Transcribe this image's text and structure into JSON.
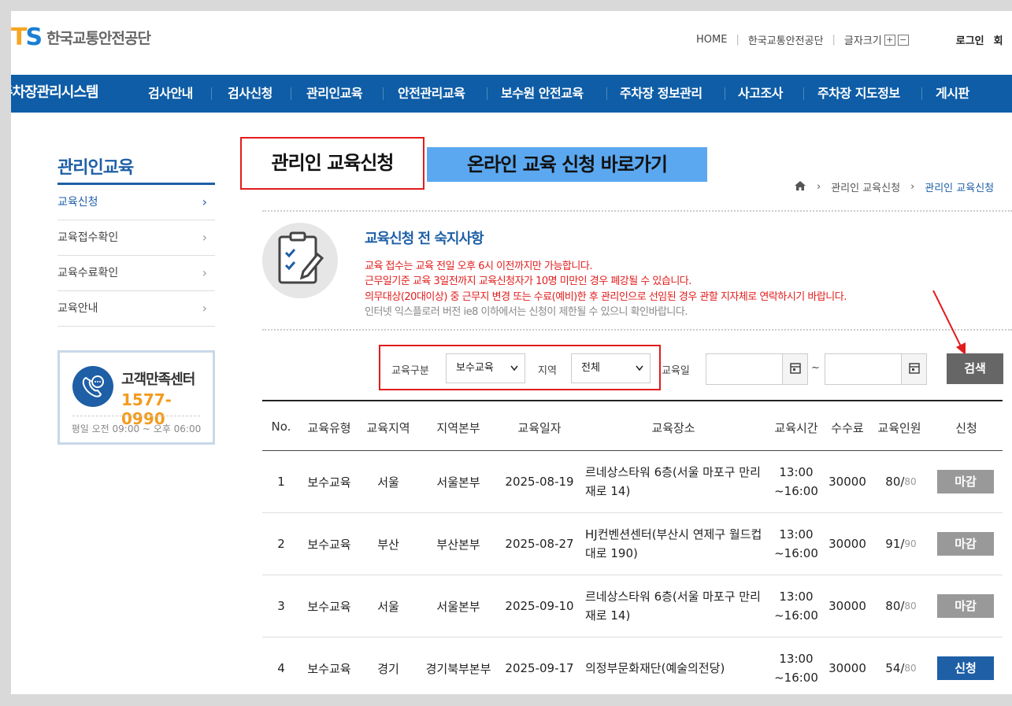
{
  "header": {
    "logo_mark": "TS",
    "logo_text": "한국교통안전공단",
    "util": {
      "home": "HOME",
      "org": "한국교통안전공단",
      "font_size": "글자크기",
      "font_plus": "+",
      "font_minus": "−",
      "login": "로그인",
      "more": "회"
    }
  },
  "nav": {
    "system_title": "주차장관리시스템",
    "items": [
      "검사안내",
      "검사신청",
      "관리인교육",
      "안전관리교육",
      "보수원 안전교육",
      "주차장 정보관리",
      "사고조사",
      "주차장 지도정보",
      "게시판"
    ]
  },
  "sidebar": {
    "title": "관리인교육",
    "items": [
      "교육신청",
      "교육접수확인",
      "교육수료확인",
      "교육안내"
    ],
    "arrow": "›",
    "cs": {
      "title": "고객만족센터",
      "phone": "1577-0990",
      "hours": "평일 오전 09:00 ~ 오후 06:00"
    }
  },
  "main": {
    "title": "관리인 교육신청",
    "online_link": "온라인 교육 신청 바로가기",
    "breadcrumb": [
      "관리인 교육신청",
      "관리인 교육신청"
    ],
    "breadcrumb_sep": "›",
    "notice": {
      "title": "교육신청 전 숙지사항",
      "lines_red": [
        "교육 접수는 교육 전일 오후 6시 이전까지만 가능합니다.",
        "근무일기준 교육 3일전까지 교육신청자가 10명 미만인 경우 폐강될 수 있습니다.",
        "의무대상(20대이상) 중 근무지 변경 또는 수료(예비)한 후 관리인으로 선임된 경우 관할 지자체로 연락하시기 바랍니다."
      ],
      "line_gray": "인터넷 익스플로러 버전 ie8 이하에서는 신청이 제한될 수 있으니 확인바랍니다."
    },
    "search": {
      "type_label": "교육구분",
      "type_value": "보수교육",
      "region_label": "지역",
      "region_value": "전체",
      "date_label": "교육일",
      "tilde": "~",
      "button": "검색"
    },
    "table": {
      "headers": [
        "No.",
        "교육유형",
        "교육지역",
        "지역본부",
        "교육일자",
        "교육장소",
        "교육시간",
        "수수료",
        "교육인원",
        "신청"
      ],
      "rows": [
        {
          "no": "1",
          "type": "보수교육",
          "region": "서울",
          "hq": "서울본부",
          "date": "2025-08-19",
          "place": "르네상스타워 6층(서울 마포구 만리재로 14)",
          "time_start": "13:00",
          "time_end": "~16:00",
          "fee": "30000",
          "count": "80/",
          "max": "80",
          "action": "마감",
          "status": "closed"
        },
        {
          "no": "2",
          "type": "보수교육",
          "region": "부산",
          "hq": "부산본부",
          "date": "2025-08-27",
          "place": "HJ컨벤션센터(부산시 연제구 월드컵대로 190)",
          "time_start": "13:00",
          "time_end": "~16:00",
          "fee": "30000",
          "count": "91/",
          "max": "90",
          "action": "마감",
          "status": "closed"
        },
        {
          "no": "3",
          "type": "보수교육",
          "region": "서울",
          "hq": "서울본부",
          "date": "2025-09-10",
          "place": "르네상스타워 6층(서울 마포구 만리재로 14)",
          "time_start": "13:00",
          "time_end": "~16:00",
          "fee": "30000",
          "count": "80/",
          "max": "80",
          "action": "마감",
          "status": "closed"
        },
        {
          "no": "4",
          "type": "보수교육",
          "region": "경기",
          "hq": "경기북부본부",
          "date": "2025-09-17",
          "place": "의정부문화재단(예술의전당)",
          "time_start": "13:00",
          "time_end": "~16:00",
          "fee": "30000",
          "count": "54/",
          "max": "80",
          "action": "신청",
          "status": "open"
        }
      ]
    }
  },
  "colors": {
    "brand_blue": "#0e5da6",
    "accent_orange": "#f29b1d",
    "highlight_red": "#e21c1c",
    "online_button": "#5ba8f0"
  }
}
